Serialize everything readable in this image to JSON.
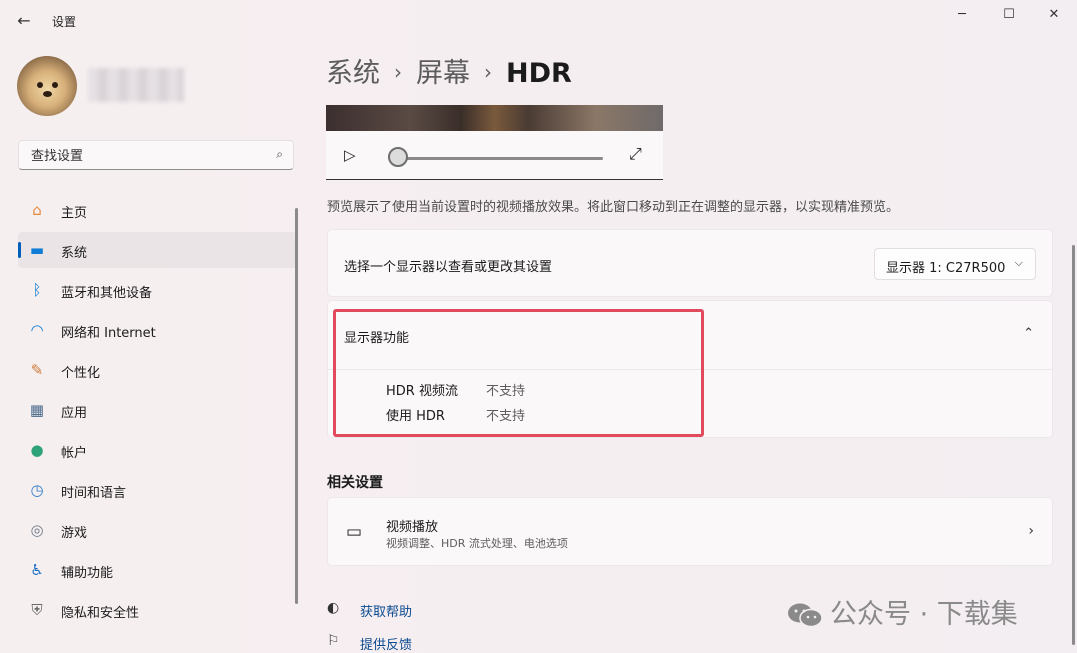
{
  "window": {
    "title": "设置",
    "back_icon": "←",
    "minimize": "─",
    "maximize": "☐",
    "close": "✕"
  },
  "search": {
    "placeholder": "查找设置",
    "icon": "⌕"
  },
  "sidebar": {
    "items": [
      {
        "label": "主页",
        "icon": "⌂",
        "icon_name": "home-icon",
        "color": "#e58a3a",
        "active": false
      },
      {
        "label": "系统",
        "icon": "▬",
        "icon_name": "system-icon",
        "color": "#0f7dd6",
        "active": true
      },
      {
        "label": "蓝牙和其他设备",
        "icon": "ᛒ",
        "icon_name": "bluetooth-icon",
        "color": "#0f7dd6",
        "active": false
      },
      {
        "label": "网络和 Internet",
        "icon": "◠",
        "icon_name": "wifi-icon",
        "color": "#0f7dd6",
        "active": false
      },
      {
        "label": "个性化",
        "icon": "✎",
        "icon_name": "paint-brush-icon",
        "color": "#d07b3a",
        "active": false
      },
      {
        "label": "应用",
        "icon": "▦",
        "icon_name": "apps-icon",
        "color": "#4a6a8a",
        "active": false
      },
      {
        "label": "帐户",
        "icon": "●",
        "icon_name": "account-icon",
        "color": "#2ea37a",
        "active": false
      },
      {
        "label": "时间和语言",
        "icon": "◷",
        "icon_name": "time-language-icon",
        "color": "#2b7bc8",
        "active": false
      },
      {
        "label": "游戏",
        "icon": "◎",
        "icon_name": "gaming-icon",
        "color": "#6b7a8a",
        "active": false
      },
      {
        "label": "辅助功能",
        "icon": "♿",
        "icon_name": "accessibility-icon",
        "color": "#1a6fc2",
        "active": false
      },
      {
        "label": "隐私和安全性",
        "icon": "⛨",
        "icon_name": "shield-icon",
        "color": "#6b6b6b",
        "active": false
      }
    ]
  },
  "breadcrumb": {
    "level1": "系统",
    "level2": "屏幕",
    "current": "HDR",
    "sep": "›"
  },
  "preview": {
    "play_icon": "▷",
    "expand_icon": "⤢",
    "note": "预览展示了使用当前设置时的视频播放效果。将此窗口移动到正在调整的显示器，以实现精准预览。"
  },
  "display_select": {
    "label": "选择一个显示器以查看或更改其设置",
    "value": "显示器 1: C27R500",
    "chevron": "⌵"
  },
  "features": {
    "title": "显示器功能",
    "collapse_icon": "⌃",
    "rows": [
      {
        "name": "HDR 视频流",
        "value": "不支持"
      },
      {
        "name": "使用 HDR",
        "value": "不支持"
      }
    ]
  },
  "related": {
    "title": "相关设置",
    "video": {
      "title": "视频播放",
      "subtitle": "视频调整、HDR 流式处理、电池选项",
      "icon": "▭",
      "arrow": "›"
    }
  },
  "help": {
    "get_help": "获取帮助",
    "feedback": "提供反馈"
  },
  "watermark": "公众号 · 下载集",
  "colors": {
    "accent": "#005fb8",
    "highlight": "#e24a5e",
    "link": "#0c4a90"
  }
}
